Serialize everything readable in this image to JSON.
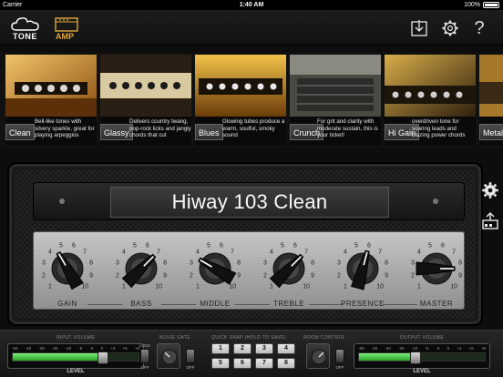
{
  "status_bar": {
    "carrier": "Carrier",
    "time": "1:40 AM",
    "battery": "100%"
  },
  "topbar": {
    "tone_label": "TONE",
    "amp_label": "AMP",
    "help_label": "?",
    "icons": [
      "tone-cloud-icon",
      "amp-icon",
      "save-download-icon",
      "gear-icon",
      "help-icon"
    ]
  },
  "presets": [
    {
      "name": "Clean",
      "desc": "Bell-like tones with silvery sparkle, great for playing arpeggios",
      "palette": [
        "#b8751c",
        "#f0c36a"
      ]
    },
    {
      "name": "Glassy",
      "desc": "Delivers country twang, pop-rock licks and jangly chords that cut",
      "palette": [
        "#2a1f14",
        "#d8c9a1"
      ]
    },
    {
      "name": "Blues",
      "desc": "Glowing tubes produce a warm, soulful, smoky sound",
      "palette": [
        "#c9901f",
        "#1a1209"
      ]
    },
    {
      "name": "Crunch",
      "desc": "For grit and clarity with moderate sustain, this is your ticket!",
      "palette": [
        "#6e6e66",
        "#2b2b28"
      ]
    },
    {
      "name": "Hi Gain",
      "desc": "overdriven tone for soaring leads and blazing power chords",
      "palette": [
        "#b58a2c",
        "#2e1f0e"
      ]
    },
    {
      "name": "Metal",
      "desc": "",
      "palette": [
        "#a6782c",
        "#3a2914"
      ]
    }
  ],
  "amp": {
    "preset_title": "Hiway 103 Clean",
    "knobs": [
      {
        "label": "GAIN",
        "value": 4.5
      },
      {
        "label": "BASS",
        "value": 7
      },
      {
        "label": "MIDDLE",
        "value": 3.5
      },
      {
        "label": "TREBLE",
        "value": 7
      },
      {
        "label": "PRESENCE",
        "value": 6
      },
      {
        "label": "MASTER",
        "value": 8.5
      }
    ],
    "dial_numbers": [
      "1",
      "2",
      "3",
      "4",
      "5",
      "6",
      "7",
      "8",
      "9",
      "10"
    ]
  },
  "bottombar": {
    "input_title": "INPUT VOLUME",
    "input_level_label": "LEVEL",
    "input_level": 0.72,
    "lock_label": "LOCK",
    "off_label": "OFF",
    "noise_gate_title": "NOISE GATE",
    "quick_snap_title": "QUICK SNAP (HOLD TO SAVE)",
    "quick_snaps": [
      "1",
      "2",
      "3",
      "4",
      "5",
      "6",
      "7",
      "8"
    ],
    "room_control_title": "ROOM CONTROL",
    "output_title": "OUTPUT VOLUME",
    "output_level_label": "LEVEL",
    "output_level": 0.45,
    "meter_scale": [
      "-50",
      "-40",
      "-30",
      "-20",
      "-10",
      "-5",
      "-3",
      "0",
      "+3",
      "+6",
      "+8"
    ]
  },
  "colors": {
    "accent": "#e0a73a",
    "meter_green": "#4cd64c"
  }
}
